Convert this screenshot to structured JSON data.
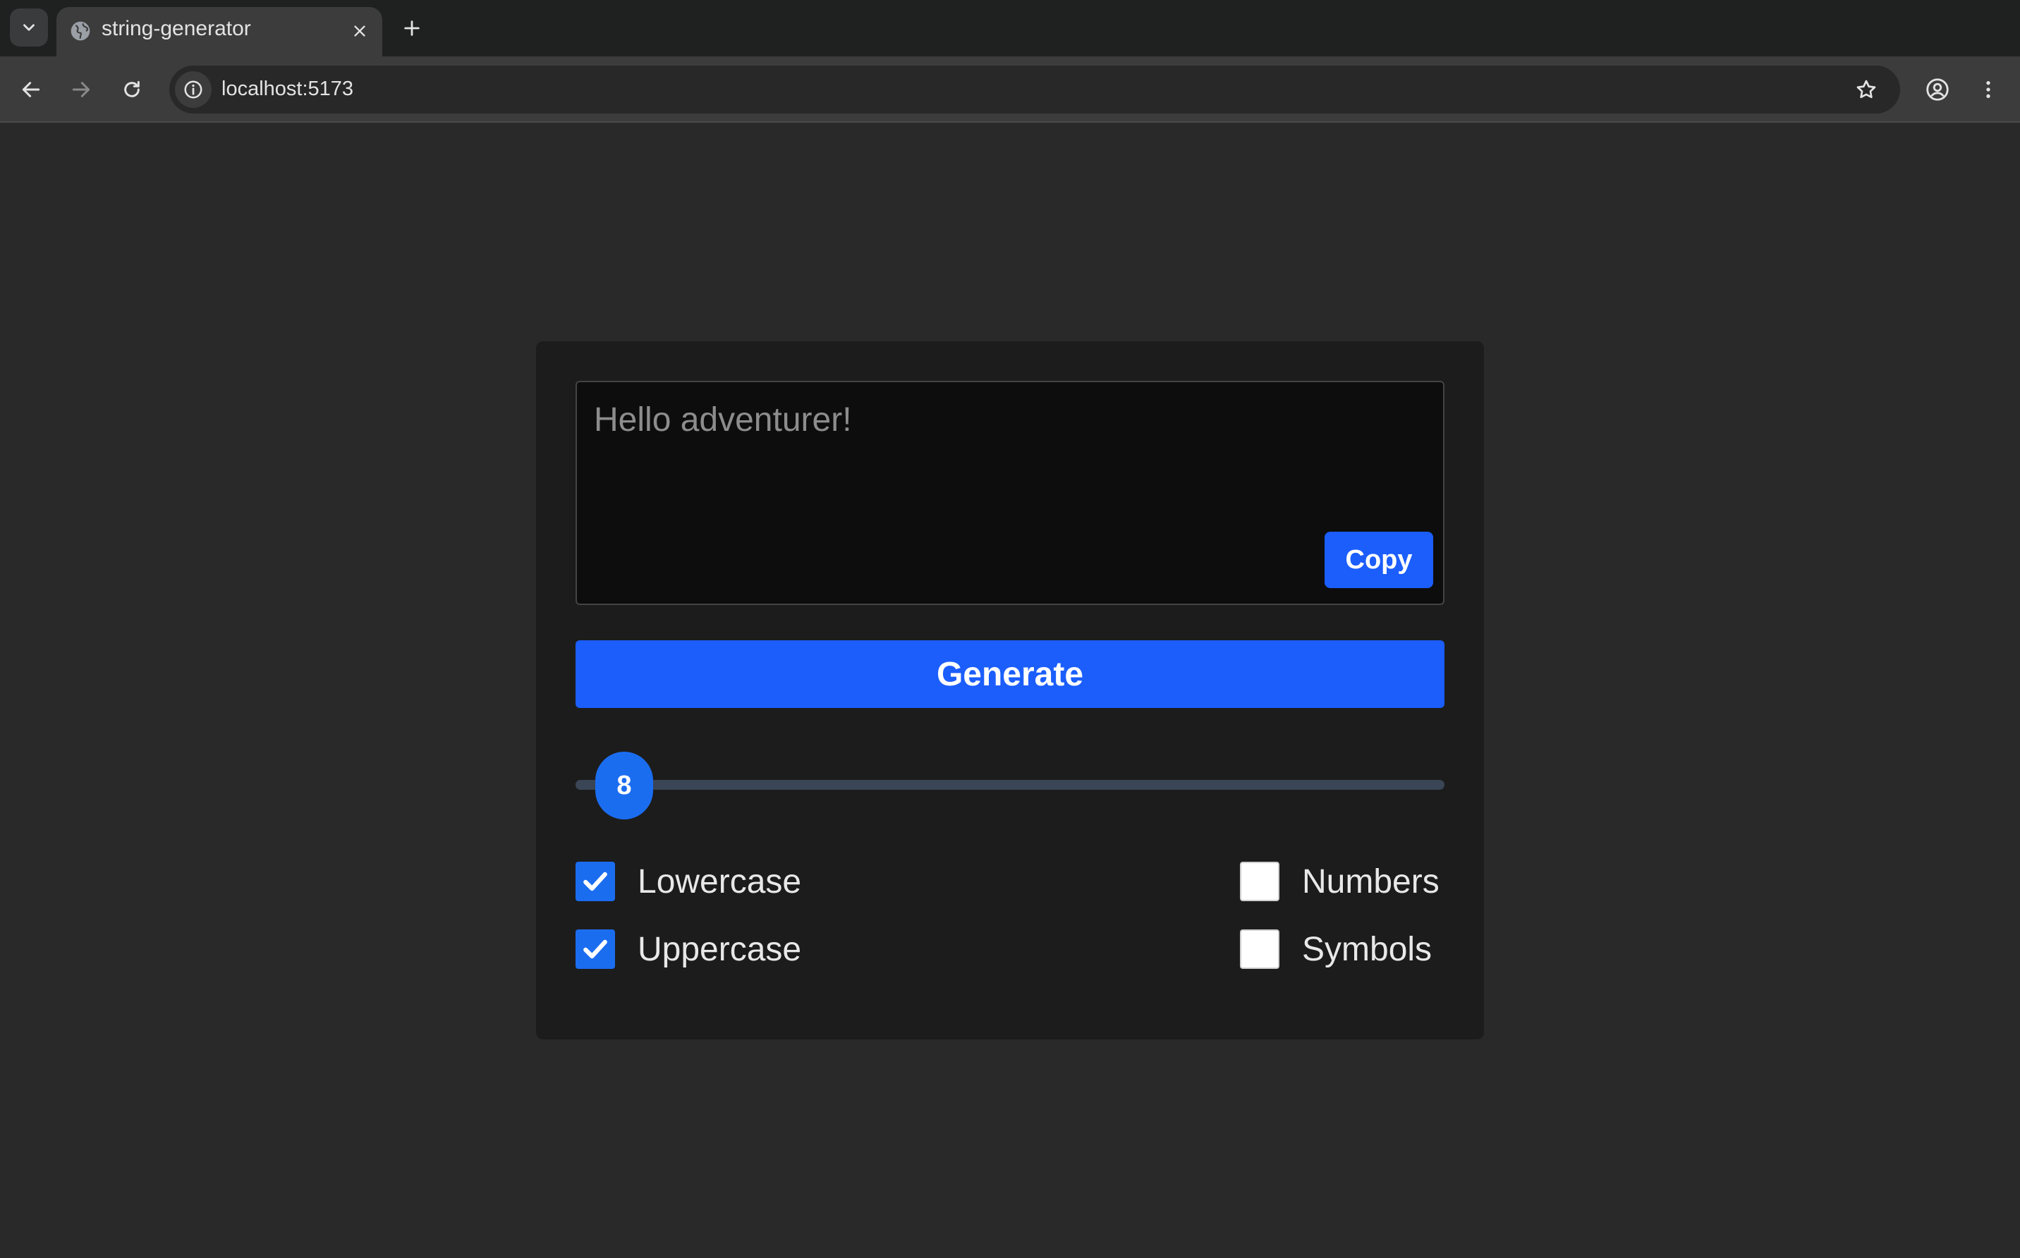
{
  "browser": {
    "tab_title": "string-generator",
    "url": "localhost:5173"
  },
  "app": {
    "output_placeholder": "Hello adventurer!",
    "output_value": "",
    "copy_label": "Copy",
    "generate_label": "Generate",
    "length": {
      "value": "8",
      "min": 8,
      "max": 64
    },
    "options": [
      {
        "label": "Lowercase",
        "checked": true
      },
      {
        "label": "Uppercase",
        "checked": true
      },
      {
        "label": "Numbers",
        "checked": false
      },
      {
        "label": "Symbols",
        "checked": false
      }
    ]
  },
  "colors": {
    "accent": "#1b5efc",
    "page_background": "#292929",
    "card_background": "#1c1c1c"
  }
}
